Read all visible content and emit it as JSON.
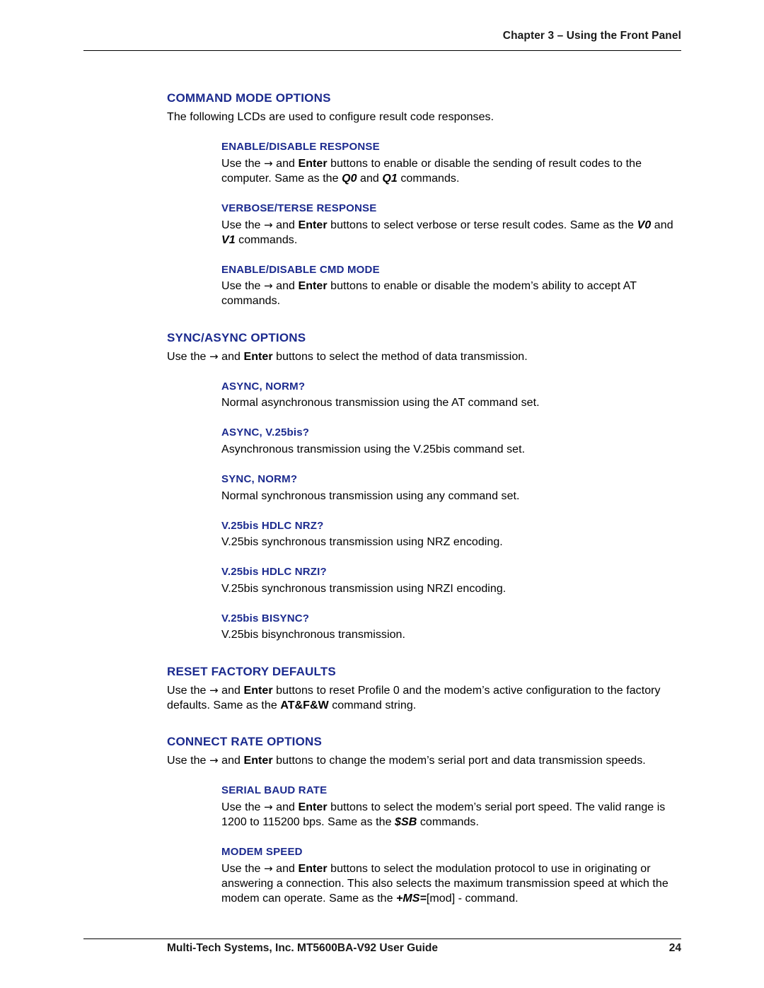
{
  "header": {
    "chapter": "Chapter 3 – Using the Front Panel"
  },
  "footer": {
    "left": "Multi-Tech Systems, Inc. MT5600BA-V92 User Guide",
    "page_number": "24"
  },
  "sections": [
    {
      "title": "COMMAND MODE OPTIONS",
      "intro": "The following LCDs are used to configure result code responses.",
      "subsections": [
        {
          "title": "ENABLE/DISABLE RESPONSE",
          "body_parts": [
            {
              "t": "Use the ",
              "s": "n"
            },
            {
              "t": "→",
              "s": "arrow"
            },
            {
              "t": " and ",
              "s": "n"
            },
            {
              "t": "Enter",
              "s": "b"
            },
            {
              "t": " buttons to enable or disable the sending of result codes to the computer. Same as the ",
              "s": "n"
            },
            {
              "t": "Q0",
              "s": "bi"
            },
            {
              "t": " and ",
              "s": "n"
            },
            {
              "t": "Q1",
              "s": "bi"
            },
            {
              "t": " commands.",
              "s": "n"
            }
          ]
        },
        {
          "title": "VERBOSE/TERSE RESPONSE",
          "body_parts": [
            {
              "t": "Use the ",
              "s": "n"
            },
            {
              "t": "→",
              "s": "arrow"
            },
            {
              "t": " and ",
              "s": "n"
            },
            {
              "t": "Enter",
              "s": "b"
            },
            {
              "t": " buttons to select verbose or terse result codes. Same as the ",
              "s": "n"
            },
            {
              "t": "V0",
              "s": "bi"
            },
            {
              "t": " and ",
              "s": "n"
            },
            {
              "t": "V1",
              "s": "bi"
            },
            {
              "t": " commands.",
              "s": "n"
            }
          ]
        },
        {
          "title": "ENABLE/DISABLE CMD MODE",
          "body_parts": [
            {
              "t": "Use the ",
              "s": "n"
            },
            {
              "t": "→",
              "s": "arrow"
            },
            {
              "t": " and ",
              "s": "n"
            },
            {
              "t": "Enter",
              "s": "b"
            },
            {
              "t": " buttons to enable or disable the modem’s ability to accept AT commands.",
              "s": "n"
            }
          ]
        }
      ]
    },
    {
      "title": "SYNC/ASYNC OPTIONS",
      "intro_parts": [
        {
          "t": "Use the ",
          "s": "n"
        },
        {
          "t": "→",
          "s": "arrow"
        },
        {
          "t": " and ",
          "s": "n"
        },
        {
          "t": "Enter",
          "s": "b"
        },
        {
          "t": " buttons to select the method of data transmission.",
          "s": "n"
        }
      ],
      "subsections": [
        {
          "title": "ASYNC, NORM?",
          "body_parts": [
            {
              "t": "Normal asynchronous transmission using the AT command set.",
              "s": "n"
            }
          ]
        },
        {
          "title": "ASYNC, V.25bis?",
          "body_parts": [
            {
              "t": "Asynchronous transmission using the V.25bis command set.",
              "s": "n"
            }
          ]
        },
        {
          "title": "SYNC, NORM?",
          "body_parts": [
            {
              "t": "Normal synchronous transmission using any command set.",
              "s": "n"
            }
          ]
        },
        {
          "title": "V.25bis HDLC NRZ?",
          "body_parts": [
            {
              "t": "V.25bis synchronous transmission using NRZ encoding.",
              "s": "n"
            }
          ]
        },
        {
          "title": "V.25bis HDLC NRZI?",
          "body_parts": [
            {
              "t": "V.25bis synchronous transmission using NRZI encoding.",
              "s": "n"
            }
          ]
        },
        {
          "title": "V.25bis BISYNC?",
          "body_parts": [
            {
              "t": "V.25bis bisynchronous transmission.",
              "s": "n"
            }
          ]
        }
      ]
    },
    {
      "title": "RESET FACTORY DEFAULTS",
      "intro_parts": [
        {
          "t": "Use the ",
          "s": "n"
        },
        {
          "t": "→",
          "s": "arrow"
        },
        {
          "t": " and ",
          "s": "n"
        },
        {
          "t": "Enter",
          "s": "b"
        },
        {
          "t": " buttons to reset Profile 0 and the modem’s active configuration to the factory defaults. Same as the ",
          "s": "n"
        },
        {
          "t": "AT&F&W",
          "s": "b"
        },
        {
          "t": " command string.",
          "s": "n"
        }
      ],
      "subsections": []
    },
    {
      "title": "CONNECT RATE OPTIONS",
      "intro_parts": [
        {
          "t": "Use the ",
          "s": "n"
        },
        {
          "t": "→",
          "s": "arrow"
        },
        {
          "t": " and ",
          "s": "n"
        },
        {
          "t": "Enter",
          "s": "b"
        },
        {
          "t": " buttons to change the modem’s serial port and data transmission speeds.",
          "s": "n"
        }
      ],
      "subsections": [
        {
          "title": "SERIAL BAUD RATE",
          "body_parts": [
            {
              "t": "Use the ",
              "s": "n"
            },
            {
              "t": "→",
              "s": "arrow"
            },
            {
              "t": " and ",
              "s": "n"
            },
            {
              "t": "Enter",
              "s": "b"
            },
            {
              "t": " buttons to select the modem’s serial port speed. The valid range is 1200 to 115200 bps. Same as the ",
              "s": "n"
            },
            {
              "t": "$SB",
              "s": "bi"
            },
            {
              "t": " commands.",
              "s": "n"
            }
          ]
        },
        {
          "title": "MODEM SPEED",
          "body_parts": [
            {
              "t": "Use the ",
              "s": "n"
            },
            {
              "t": "→",
              "s": "arrow"
            },
            {
              "t": " and ",
              "s": "n"
            },
            {
              "t": "Enter",
              "s": "b"
            },
            {
              "t": " buttons to select the modulation protocol to use in originating or answering a connection. This also selects the maximum transmission speed at which the modem can operate. Same as the ",
              "s": "n"
            },
            {
              "t": "+MS=",
              "s": "bi"
            },
            {
              "t": "[mod]",
              "s": "n"
            },
            {
              "t": " - command.",
              "s": "n"
            }
          ]
        }
      ]
    }
  ]
}
